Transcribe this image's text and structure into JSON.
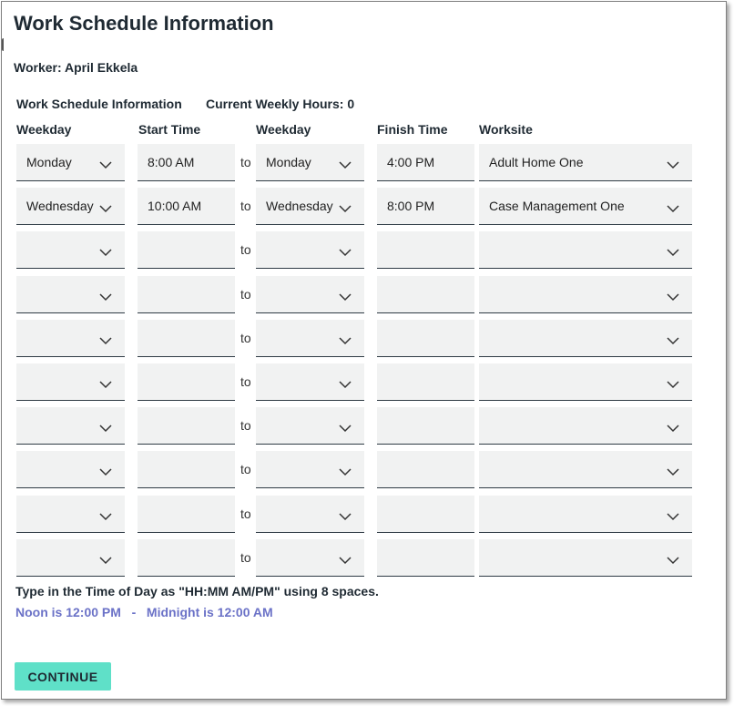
{
  "page": {
    "title": "Work Schedule Information",
    "worker": "Worker: April Ekkela",
    "section_label": "Work Schedule Information",
    "weekly_hours": "Current Weekly Hours: 0"
  },
  "columns": {
    "weekday_start": "Weekday",
    "start_time": "Start Time",
    "weekday_end": "Weekday",
    "finish_time": "Finish Time",
    "worksite": "Worksite"
  },
  "rows": [
    {
      "start_day": "Monday",
      "start_time": "8:00 AM",
      "to": "to",
      "end_day": "Monday",
      "finish_time": "4:00 PM",
      "worksite": "Adult Home One"
    },
    {
      "start_day": "Wednesday",
      "start_time": "10:00 AM",
      "to": "to",
      "end_day": "Wednesday",
      "finish_time": "8:00 PM",
      "worksite": "Case Management One"
    },
    {
      "start_day": "",
      "start_time": "",
      "to": "to",
      "end_day": "",
      "finish_time": "",
      "worksite": ""
    },
    {
      "start_day": "",
      "start_time": "",
      "to": "to",
      "end_day": "",
      "finish_time": "",
      "worksite": ""
    },
    {
      "start_day": "",
      "start_time": "",
      "to": "to",
      "end_day": "",
      "finish_time": "",
      "worksite": ""
    },
    {
      "start_day": "",
      "start_time": "",
      "to": "to",
      "end_day": "",
      "finish_time": "",
      "worksite": ""
    },
    {
      "start_day": "",
      "start_time": "",
      "to": "to",
      "end_day": "",
      "finish_time": "",
      "worksite": ""
    },
    {
      "start_day": "",
      "start_time": "",
      "to": "to",
      "end_day": "",
      "finish_time": "",
      "worksite": ""
    },
    {
      "start_day": "",
      "start_time": "",
      "to": "to",
      "end_day": "",
      "finish_time": "",
      "worksite": ""
    },
    {
      "start_day": "",
      "start_time": "",
      "to": "to",
      "end_day": "",
      "finish_time": "",
      "worksite": ""
    }
  ],
  "help": {
    "format_hint": "Type in the Time of Day as \"HH:MM AM/PM\" using 8 spaces.",
    "noon_midnight": "Noon is 12:00 PM   -   Midnight is 12:00 AM"
  },
  "actions": {
    "continue_label": "CONTINUE"
  },
  "icons": {
    "dropdown": "chevron-down-icon"
  },
  "colors": {
    "field_bg": "#f1f2f2",
    "accent_button": "#5fe0c8",
    "note_text": "#6b72c7"
  }
}
